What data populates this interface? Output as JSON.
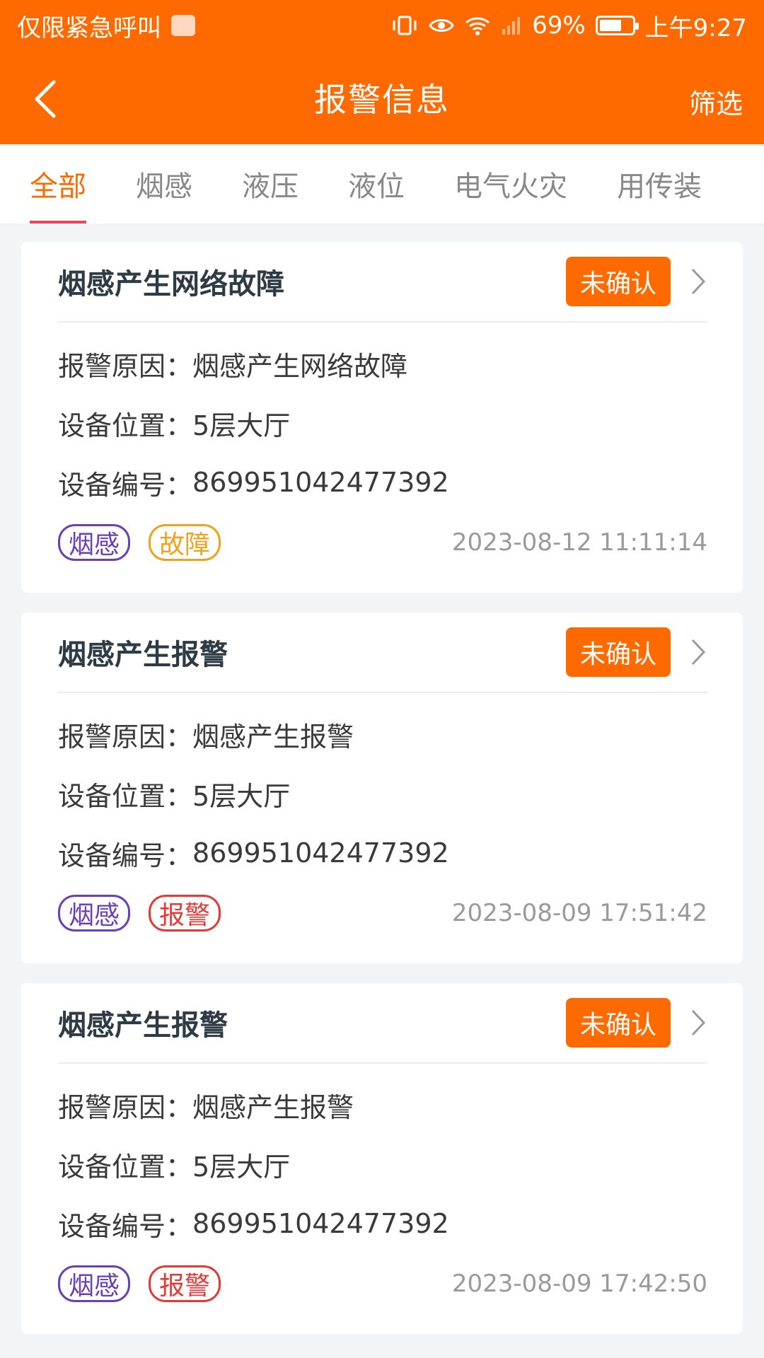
{
  "status_bar": {
    "left_text": "仅限紧急呼叫",
    "battery_percent": "69%",
    "battery_level": 0.69,
    "time": "上午9:27"
  },
  "header": {
    "title": "报警信息",
    "filter_label": "筛选"
  },
  "tabs": [
    {
      "label": "全部",
      "active": true
    },
    {
      "label": "烟感",
      "active": false
    },
    {
      "label": "液压",
      "active": false
    },
    {
      "label": "液位",
      "active": false
    },
    {
      "label": "电气火灾",
      "active": false
    },
    {
      "label": "用传装",
      "active": false
    }
  ],
  "cards": [
    {
      "title": "烟感产生网络故障",
      "status": "未确认",
      "reason_label": "报警原因：",
      "reason": "烟感产生网络故障",
      "location_label": "设备位置：",
      "location": "5层大厅",
      "device_label": "设备编号：",
      "device_id": "869951042477392",
      "tag1": "烟感",
      "tag2": "故障",
      "time": "2023-08-12 11:11:14"
    },
    {
      "title": "烟感产生报警",
      "status": "未确认",
      "reason_label": "报警原因：",
      "reason": "烟感产生报警",
      "location_label": "设备位置：",
      "location": "5层大厅",
      "device_label": "设备编号：",
      "device_id": "869951042477392",
      "tag1": "烟感",
      "tag2": "报警",
      "time": "2023-08-09 17:51:42"
    },
    {
      "title": "烟感产生报警",
      "status": "未确认",
      "reason_label": "报警原因：",
      "reason": "烟感产生报警",
      "location_label": "设备位置：",
      "location": "5层大厅",
      "device_label": "设备编号：",
      "device_id": "869951042477392",
      "tag1": "烟感",
      "tag2": "报警",
      "time": "2023-08-09 17:42:50"
    }
  ],
  "colors": {
    "primary": "#ff6a00",
    "tag_purple": "#6b3fb5",
    "tag_orange": "#f0a21c",
    "tag_red": "#e53935"
  }
}
